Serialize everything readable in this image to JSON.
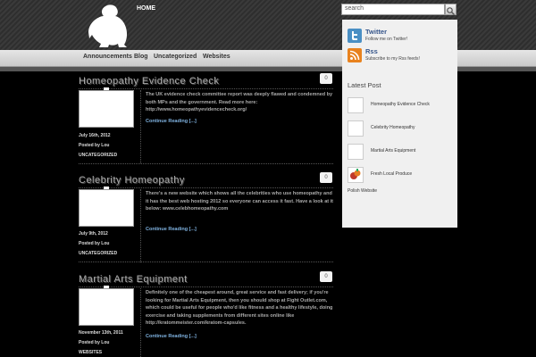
{
  "header": {
    "nav_home": "HOME",
    "search_value": "search"
  },
  "menu": {
    "items": [
      "Announcements",
      "Blog",
      "Uncategorized",
      "Websites"
    ]
  },
  "posts": [
    {
      "title": "Homeopathy Evidence Check",
      "comments": "0",
      "date": "July 16th, 2012",
      "author": "Posted by Lou",
      "category": "UNCATEGORIZED",
      "excerpt": "The UK evidence check committee report was deeply flawed and condemned by both MPs and the government. Read more here: http://www.homeopathyevidencecheck.org/",
      "continue": "Continue Reading [...]"
    },
    {
      "title": "Celebrity Homeopathy",
      "comments": "0",
      "date": "July 9th, 2012",
      "author": "Posted by Lou",
      "category": "UNCATEGORIZED",
      "excerpt": "There's a new website which shows all the celebrities who use homeopathy and it has the best web hosting 2012 so everyone can access it fast. Have a look at it below: www.celebhomeopathy.com",
      "continue": "Continue Reading [...]"
    },
    {
      "title": "Martial Arts Equipment",
      "comments": "0",
      "date": "November 13th, 2011",
      "author": "Posted by Lou",
      "category": "WEBSITES",
      "excerpt": "Definitely one of the cheapest around, great service and fast delivery; if you're looking for Martial Arts Equipment, then you should shop at Fight Outlet.com, which could be useful for people who'd like fitness and a healthy lifestyle, doing exercise and taking supplements from different sites online like http://kratommeister.com/kratom-capsules.",
      "continue": "Continue Reading [...]"
    }
  ],
  "sidebar": {
    "social": [
      {
        "name": "Twitter",
        "desc": "Follow me on Twitter!",
        "icon": "twitter-icon",
        "color": "#4a8fc4"
      },
      {
        "name": "Rss",
        "desc": "Subscribe to my Rss feeds!",
        "icon": "rss-icon",
        "color": "#e8821e"
      }
    ],
    "latest_title": "Latest Post",
    "latest": [
      "Homeopathy Evidence Check",
      "Celebrity Homeopathy",
      "Martial Arts Equipment",
      "Fresh Local Produce"
    ],
    "polish": "Polish Website"
  }
}
